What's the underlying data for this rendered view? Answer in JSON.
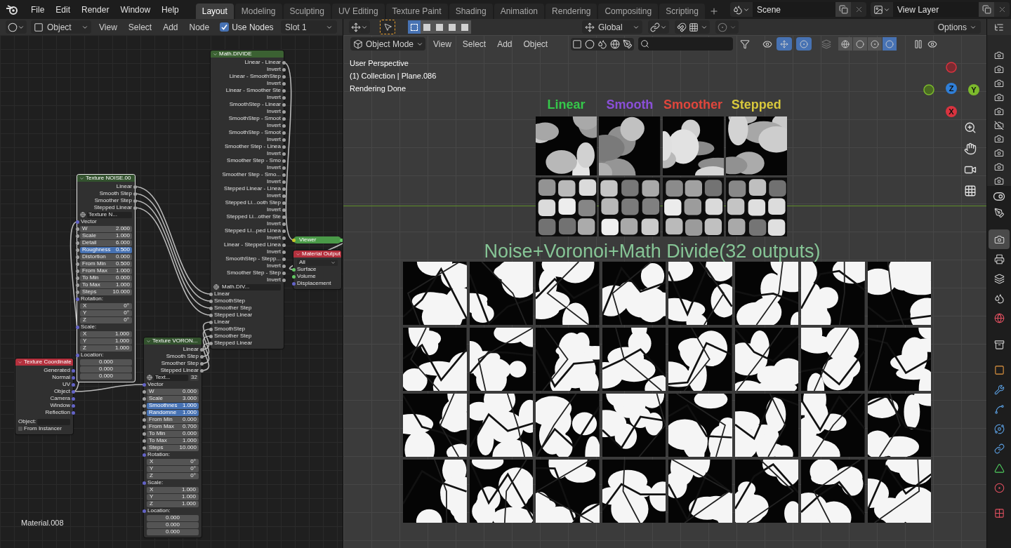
{
  "menu": [
    "File",
    "Edit",
    "Render",
    "Window",
    "Help"
  ],
  "workspaces": [
    {
      "label": "Layout",
      "selected": true
    },
    {
      "label": "Modeling",
      "selected": false
    },
    {
      "label": "Sculpting",
      "selected": false
    },
    {
      "label": "UV Editing",
      "selected": false
    },
    {
      "label": "Texture Paint",
      "selected": false
    },
    {
      "label": "Shading",
      "selected": false
    },
    {
      "label": "Animation",
      "selected": false
    },
    {
      "label": "Rendering",
      "selected": false
    },
    {
      "label": "Compositing",
      "selected": false
    },
    {
      "label": "Scripting",
      "selected": false
    }
  ],
  "scene": "Scene",
  "view_layer": "View Layer",
  "node_editor": {
    "object_type": "Object",
    "menus": [
      "View",
      "Select",
      "Add",
      "Node"
    ],
    "use_nodes": {
      "label": "Use Nodes",
      "checked": true
    },
    "slot": "Slot 1",
    "material": "Material.008",
    "nodes": [
      {
        "kind": "node",
        "title": "Math.DIVIDE",
        "color": "#3b6132",
        "selected": false,
        "rows": [
          {
            "kind": "output",
            "label": "Linear - Linear"
          },
          {
            "kind": "output",
            "label": "Invert"
          },
          {
            "kind": "output",
            "label": "Linear - SmoothStep"
          },
          {
            "kind": "output",
            "label": "Invert"
          },
          {
            "kind": "output",
            "label": "Linear - Smoother Ste"
          },
          {
            "kind": "output",
            "label": "Invert"
          },
          {
            "kind": "output",
            "label": "SmoothStep - Linear"
          },
          {
            "kind": "output",
            "label": "Invert"
          },
          {
            "kind": "output",
            "label": "SmoothStep - Smoot"
          },
          {
            "kind": "output",
            "label": "Invert"
          },
          {
            "kind": "output",
            "label": "SmoothStep - Smoot"
          },
          {
            "kind": "output",
            "label": "Invert"
          },
          {
            "kind": "output",
            "label": "Smoother Step - Linea"
          },
          {
            "kind": "output",
            "label": "Invert"
          },
          {
            "kind": "output",
            "label": "Smoother Step - Smo"
          },
          {
            "kind": "output",
            "label": "Invert"
          },
          {
            "kind": "output",
            "label": "Smoother Step - Smo..."
          },
          {
            "kind": "output",
            "label": "Invert"
          },
          {
            "kind": "output",
            "label": "Stepped Linear - Linea"
          },
          {
            "kind": "output",
            "label": "Invert"
          },
          {
            "kind": "output",
            "label": "Stepped Li...ooth Step"
          },
          {
            "kind": "output",
            "label": "Invert"
          },
          {
            "kind": "output",
            "label": "Stepped Li...other Ste"
          },
          {
            "kind": "output",
            "label": "Invert"
          },
          {
            "kind": "output",
            "label": "Stepped Li...ped Linea"
          },
          {
            "kind": "output",
            "label": "Invert"
          },
          {
            "kind": "output",
            "label": "Linear - Stepped Linea"
          },
          {
            "kind": "output",
            "label": "Invert"
          },
          {
            "kind": "output",
            "label": "SmoothStep - Stepp..."
          },
          {
            "kind": "output",
            "label": "Invert"
          },
          {
            "kind": "output",
            "label": "Smoother Step - Step"
          },
          {
            "kind": "output",
            "label": "Invert"
          },
          {
            "kind": "selector",
            "label": "Math.DIV..."
          },
          {
            "kind": "input",
            "label": "Linear"
          },
          {
            "kind": "input",
            "label": "SmoothStep"
          },
          {
            "kind": "input",
            "label": "Smoother Step"
          },
          {
            "kind": "input",
            "label": "Stepped Linear"
          },
          {
            "kind": "input",
            "label": "Linear"
          },
          {
            "kind": "input",
            "label": "SmoothStep"
          },
          {
            "kind": "input",
            "label": "Smoother Step"
          },
          {
            "kind": "input",
            "label": "Stepped Linear"
          }
        ]
      },
      {
        "kind": "node",
        "title": "Texture NOISE.00",
        "color": "#33522e",
        "selected": true,
        "rows": [
          {
            "kind": "output",
            "label": "Linear"
          },
          {
            "kind": "output",
            "label": "Smooth Step"
          },
          {
            "kind": "output",
            "label": "Smoother Step"
          },
          {
            "kind": "output",
            "label": "Stepped Linear"
          },
          {
            "kind": "selector",
            "label": "Texture N..."
          },
          {
            "kind": "heading",
            "label": "Vector"
          },
          {
            "kind": "field",
            "label": "W",
            "value": "2.000",
            "highlighted": false
          },
          {
            "kind": "field",
            "label": "Scale",
            "value": "1.000",
            "highlighted": false
          },
          {
            "kind": "field",
            "label": "Detail",
            "value": "6.000",
            "highlighted": false
          },
          {
            "kind": "field",
            "label": "Roughness",
            "value": "0.500",
            "highlighted": true
          },
          {
            "kind": "field",
            "label": "Distortion",
            "value": "0.000",
            "highlighted": false
          },
          {
            "kind": "field",
            "label": "From Min",
            "value": "0.500",
            "highlighted": false
          },
          {
            "kind": "field",
            "label": "From Max",
            "value": "1.000",
            "highlighted": false
          },
          {
            "kind": "field",
            "label": "To Min",
            "value": "0.000",
            "highlighted": false
          },
          {
            "kind": "field",
            "label": "To Max",
            "value": "1.000",
            "highlighted": false
          },
          {
            "kind": "field",
            "label": "Steps",
            "value": "10.000",
            "highlighted": false
          },
          {
            "kind": "heading",
            "label": "Rotation:"
          },
          {
            "kind": "axis",
            "label": "X",
            "value": "0°"
          },
          {
            "kind": "axis",
            "label": "Y",
            "value": "0°"
          },
          {
            "kind": "axis",
            "label": "Z",
            "value": "0°"
          },
          {
            "kind": "heading",
            "label": "Scale:"
          },
          {
            "kind": "axis",
            "label": "X",
            "value": "1.000"
          },
          {
            "kind": "axis",
            "label": "Y",
            "value": "1.000"
          },
          {
            "kind": "axis",
            "label": "Z",
            "value": "1.000"
          },
          {
            "kind": "heading",
            "label": "Location:"
          },
          {
            "kind": "value",
            "value": "0.000"
          },
          {
            "kind": "value",
            "value": "0.000"
          },
          {
            "kind": "value",
            "value": "0.000"
          }
        ]
      },
      {
        "kind": "viewer",
        "title": "Viewer",
        "color": "#4a9a48",
        "selected": false
      },
      {
        "kind": "node",
        "title": "Material Output",
        "color": "#b4313e",
        "selected": false,
        "rows": [
          {
            "kind": "dropdown",
            "value": "All"
          },
          {
            "kind": "shader_input",
            "label": "Surface"
          },
          {
            "kind": "shader_input",
            "label": "Volume"
          },
          {
            "kind": "vector_input",
            "label": "Displacement"
          }
        ]
      },
      {
        "kind": "node",
        "title": "Texture VORON...",
        "color": "#33522e",
        "selected": false,
        "rows": [
          {
            "kind": "output",
            "label": "Linear"
          },
          {
            "kind": "output",
            "label": "Smooth Step"
          },
          {
            "kind": "output",
            "label": "Smoother Step"
          },
          {
            "kind": "output",
            "label": "Stepped Linear"
          },
          {
            "kind": "selector",
            "label": "Text...",
            "users": "32"
          },
          {
            "kind": "heading",
            "label": "Vector"
          },
          {
            "kind": "field",
            "label": "W",
            "value": "0.000",
            "highlighted": false
          },
          {
            "kind": "field",
            "label": "Scale",
            "value": "3.000",
            "highlighted": false
          },
          {
            "kind": "field",
            "label": "Smoothnes",
            "value": "1.000",
            "highlighted": true
          },
          {
            "kind": "field",
            "label": "Randomne",
            "value": "1.000",
            "highlighted": true
          },
          {
            "kind": "field",
            "label": "From Min",
            "value": "0.000",
            "highlighted": false
          },
          {
            "kind": "field",
            "label": "From Max",
            "value": "0.700",
            "highlighted": false
          },
          {
            "kind": "field",
            "label": "To Min",
            "value": "0.000",
            "highlighted": false
          },
          {
            "kind": "field",
            "label": "To Max",
            "value": "1.000",
            "highlighted": false
          },
          {
            "kind": "field",
            "label": "Steps",
            "value": "10.000",
            "highlighted": false
          },
          {
            "kind": "heading",
            "label": "Rotation:"
          },
          {
            "kind": "axis",
            "label": "X",
            "value": "0°"
          },
          {
            "kind": "axis",
            "label": "Y",
            "value": "0°"
          },
          {
            "kind": "axis",
            "label": "Z",
            "value": "0°"
          },
          {
            "kind": "heading",
            "label": "Scale:"
          },
          {
            "kind": "axis",
            "label": "X",
            "value": "1.000"
          },
          {
            "kind": "axis",
            "label": "Y",
            "value": "1.000"
          },
          {
            "kind": "axis",
            "label": "Z",
            "value": "1.000"
          },
          {
            "kind": "heading",
            "label": "Location:"
          },
          {
            "kind": "value",
            "value": "0.000"
          },
          {
            "kind": "value",
            "value": "0.000"
          },
          {
            "kind": "value",
            "value": "0.000"
          }
        ]
      },
      {
        "kind": "node",
        "title": "Texture Coordinate",
        "color": "#b4313e",
        "selected": false,
        "rows": [
          {
            "kind": "vector_output",
            "label": "Generated"
          },
          {
            "kind": "vector_output",
            "label": "Normal"
          },
          {
            "kind": "vector_output",
            "label": "UV"
          },
          {
            "kind": "vector_output",
            "label": "Object"
          },
          {
            "kind": "vector_output",
            "label": "Camera"
          },
          {
            "kind": "vector_output",
            "label": "Window"
          },
          {
            "kind": "vector_output",
            "label": "Reflection"
          },
          {
            "kind": "object_field",
            "label": "Object:"
          },
          {
            "kind": "checkbox",
            "label": "From Instancer",
            "checked": false
          }
        ]
      }
    ]
  },
  "viewport": {
    "orientation": "Global",
    "options": "Options",
    "mode": "Object Mode",
    "menus": [
      "View",
      "Select",
      "Add",
      "Object"
    ],
    "select_modes": [
      {
        "selected": true
      },
      {
        "selected": false
      },
      {
        "selected": false
      },
      {
        "selected": false
      },
      {
        "selected": false
      }
    ],
    "toggles": [
      {
        "kind": "gizmos",
        "on": true
      },
      {
        "kind": "overlays",
        "on": true
      }
    ],
    "shading": [
      {
        "kind": "wireframe",
        "selected": false
      },
      {
        "kind": "solid",
        "selected": false
      },
      {
        "kind": "material",
        "selected": false
      },
      {
        "kind": "rendered",
        "selected": true
      }
    ],
    "info": [
      "User Perspective",
      "(1) Collection | Plane.086",
      "Rendering Done"
    ],
    "column_labels": [
      {
        "text": "Linear",
        "color": "#35c84a"
      },
      {
        "text": "Smooth",
        "color": "#8a4fd8"
      },
      {
        "text": "Smoother",
        "color": "#e0463c"
      },
      {
        "text": "Stepped",
        "color": "#d8c83c"
      }
    ],
    "title": "Noise+Voronoi+Math Divide(32 outputs)",
    "gizmo": [
      {
        "label": "Z",
        "color": "#2f7fd8"
      },
      {
        "label": "Y",
        "color": "#7cba2c"
      },
      {
        "label": "X",
        "color": "#d9333f"
      }
    ]
  },
  "outliner": [
    {
      "render": true
    },
    {
      "render": true
    },
    {
      "render": true
    },
    {
      "render": true
    },
    {
      "render": true
    },
    {
      "render": false
    },
    {
      "render": true
    },
    {
      "render": true
    },
    {
      "render": true
    },
    {
      "render": true
    }
  ],
  "properties_tabs": [
    {
      "kind": "tool",
      "selected": false
    },
    {
      "kind": "render",
      "selected": true
    },
    {
      "kind": "output",
      "selected": false
    },
    {
      "kind": "view_layer",
      "selected": false
    },
    {
      "kind": "scene",
      "selected": false
    },
    {
      "kind": "world",
      "selected": false
    },
    {
      "kind": "collection",
      "selected": false
    },
    {
      "kind": "object",
      "selected": false
    },
    {
      "kind": "modifiers",
      "selected": false
    },
    {
      "kind": "particles",
      "selected": false
    },
    {
      "kind": "physics",
      "selected": false
    },
    {
      "kind": "constraints",
      "selected": false
    },
    {
      "kind": "data",
      "selected": false
    },
    {
      "kind": "material",
      "selected": false
    },
    {
      "kind": "texture",
      "selected": false
    }
  ]
}
